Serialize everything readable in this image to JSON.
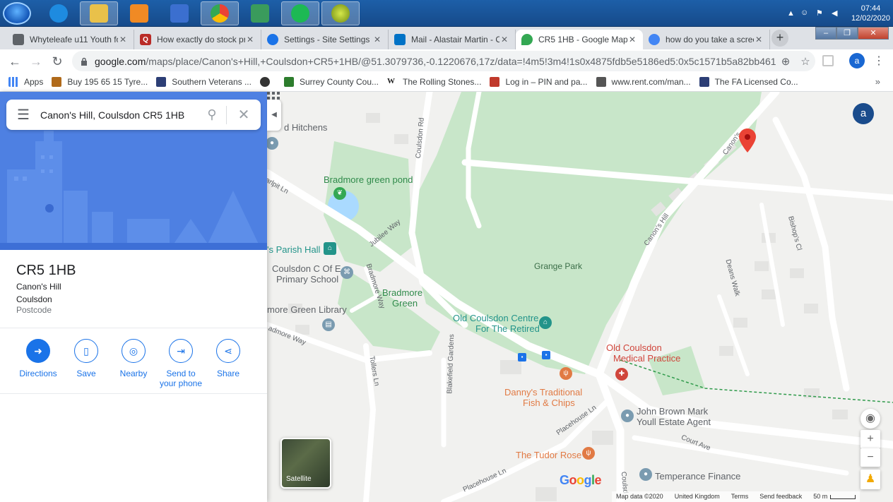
{
  "taskbar": {
    "clock_time": "07:44",
    "clock_date": "12/02/2020"
  },
  "tabs": [
    {
      "title": "Whyteleafe u11 Youth fo",
      "color": "#5f6368"
    },
    {
      "title": "How exactly do stock pr",
      "color": "#b92b27",
      "glyph": "Q"
    },
    {
      "title": "Settings - Site Settings",
      "color": "#1a73e8"
    },
    {
      "title": "Mail - Alastair Martin - O",
      "color": "#0072c6"
    },
    {
      "title": "CR5 1HB - Google Maps",
      "color": "#34a853"
    },
    {
      "title": "how do you take a scree",
      "color": "#4285f4"
    }
  ],
  "address_bar": {
    "host": "google.com",
    "rest": "/maps/place/Canon's+Hill,+Coulsdon+CR5+1HB/@51.3079736,-0.1220676,17z/data=!4m5!3m4!1s0x4875fdb5e5186ed5:0x5c1571b5a82bb461!8m2!3d51...",
    "profile_initial": "a"
  },
  "bookmarks": [
    {
      "label": "Apps",
      "color": "#4285f4"
    },
    {
      "label": "Buy 195 65 15 Tyre...",
      "color": "#b06a1a"
    },
    {
      "label": "Southern Veterans ...",
      "color": "#2c3e75"
    },
    {
      "label": "",
      "color": "#333333"
    },
    {
      "label": "Surrey County Cou...",
      "color": "#2d7d2d"
    },
    {
      "label": "The Rolling Stones...",
      "color": "#222222",
      "glyph": "W"
    },
    {
      "label": "Log in – PIN and pa...",
      "color": "#c0392b"
    },
    {
      "label": "www.rent.com/man...",
      "color": "#555555"
    },
    {
      "label": "The FA Licensed Co...",
      "color": "#2c3e75"
    }
  ],
  "search": {
    "value": "Canon's Hill, Coulsdon CR5 1HB"
  },
  "place": {
    "title": "CR5 1HB",
    "line1": "Canon's Hill",
    "line2": "Coulsdon",
    "type": "Postcode"
  },
  "actions": [
    {
      "label": "Directions"
    },
    {
      "label": "Save"
    },
    {
      "label": "Nearby"
    },
    {
      "label": "Send to your phone"
    },
    {
      "label": "Share"
    }
  ],
  "map": {
    "labels": {
      "hitchens": "d Hitchens",
      "marlpit": "arlpit Ln",
      "pond": "Bradmore green pond",
      "jubilee": "Jubilee Way",
      "coulsdon_rd": "Coulsdon Rd",
      "parish_hall": "'s Parish Hall",
      "school_1": "Coulsdon C Of E",
      "school_2": "Primary School",
      "bradmore_way": "Bradmore Way",
      "bradmore_green_1": "Bradmore",
      "bradmore_green_2": "Green",
      "library": "more Green Library",
      "grange_park": "Grange Park",
      "centre_1": "Old Coulsdon Centre",
      "centre_2": "For The Retired",
      "admore_way": "admore Way",
      "tollers": "Tollers Ln",
      "blakefield": "Blakefield Gardens",
      "medical_1": "Old Coulsdon",
      "medical_2": "Medical Practice",
      "dannys_1": "Danny's Traditional",
      "dannys_2": "Fish & Chips",
      "estate_1": "John Brown Mark",
      "estate_2": "Youll Estate Agent",
      "placehouse": "Placehouse Ln",
      "placehouse2": "Placehouse Ln",
      "court_ave": "Court Ave",
      "tudor_rose": "The Tudor Rose",
      "temperance": "Temperance Finance",
      "canons_hill": "Canon's Hill",
      "canons_top": "Canon's",
      "deans_walk": "Deans Walk",
      "bishops": "Bishop's Cl",
      "coulsd_bottom": "Coulsd"
    },
    "satellite_label": "Satellite",
    "profile_initial": "a",
    "attribution": {
      "map_data": "Map data ©2020",
      "region": "United Kingdom",
      "terms": "Terms",
      "feedback": "Send feedback",
      "scale": "50 m"
    },
    "colors": {
      "park": "#c8e6c9",
      "water": "#aadaff",
      "road": "#ffffff",
      "building": "#e8e8e8",
      "pin": "#ea4335"
    }
  }
}
